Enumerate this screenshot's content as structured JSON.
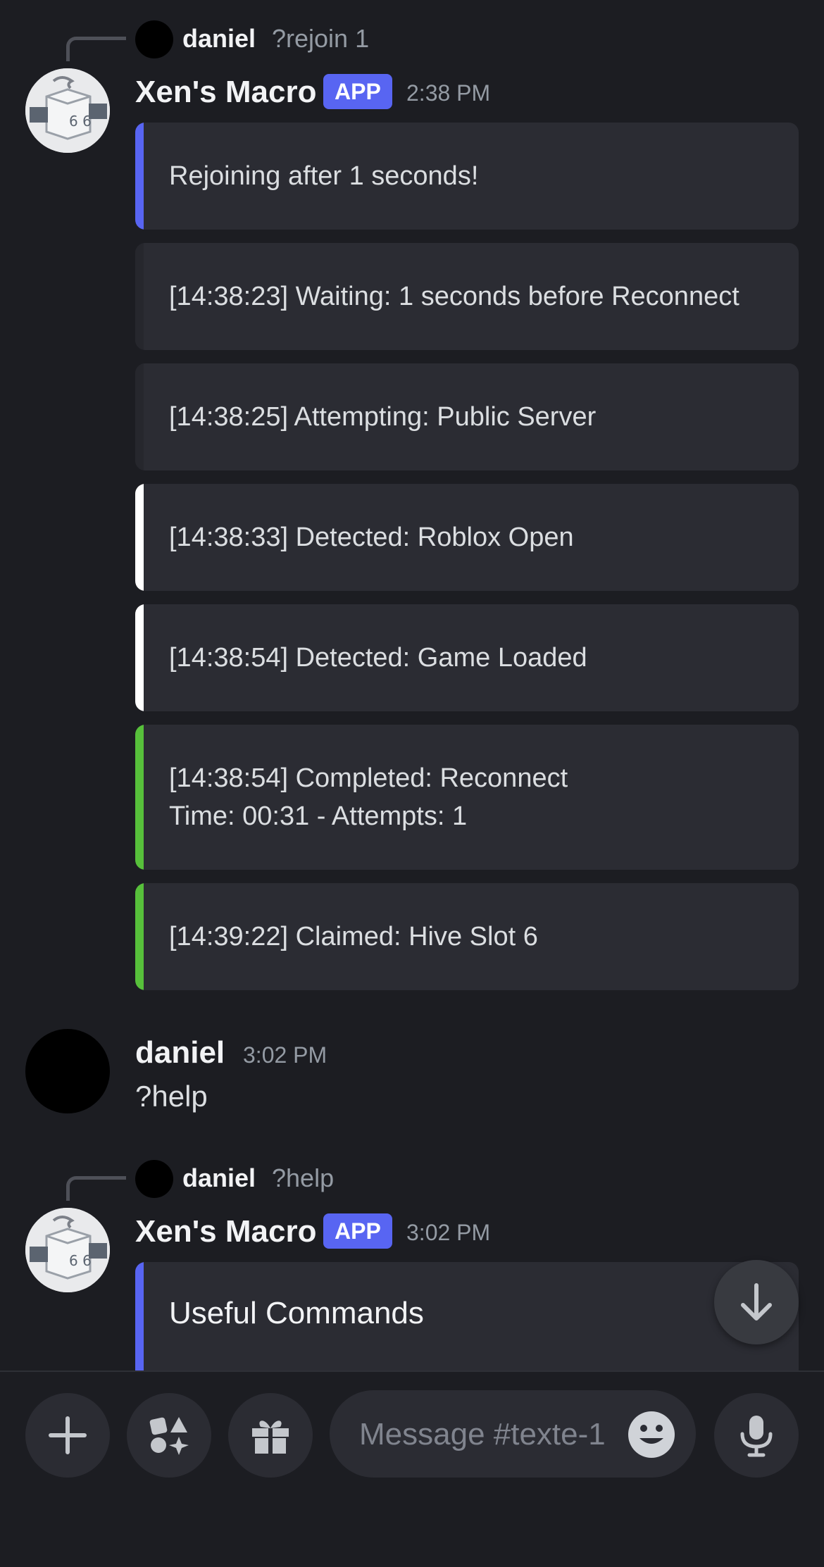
{
  "messages": {
    "m1": {
      "reply_author": "daniel",
      "reply_text": "?rejoin 1",
      "author": "Xen's Macro",
      "badge": "APP",
      "time": "2:38 PM",
      "embeds": [
        {
          "text": "Rejoining after 1 seconds!",
          "color": "#5865f2"
        },
        {
          "text": "[14:38:23] Waiting: 1 seconds before Reconnect",
          "color": "#2b2c33"
        },
        {
          "text": "[14:38:25] Attempting: Public Server",
          "color": "#2b2c33"
        },
        {
          "text": "[14:38:33] Detected: Roblox Open",
          "color": "#ffffff"
        },
        {
          "text": "[14:38:54] Detected: Game Loaded",
          "color": "#ffffff"
        },
        {
          "text": "[14:38:54] Completed: Reconnect\nTime: 00:31 - Attempts: 1",
          "color": "#57c03b"
        },
        {
          "text": "[14:39:22] Claimed: Hive Slot 6",
          "color": "#57c03b"
        }
      ]
    },
    "m2": {
      "author": "daniel",
      "time": "3:02 PM",
      "text": "?help"
    },
    "m3": {
      "reply_author": "daniel",
      "reply_text": "?help",
      "author": "Xen's Macro",
      "badge": "APP",
      "time": "3:02 PM",
      "embed_title": "Useful Commands",
      "embed_color": "#5865f2"
    }
  },
  "composer": {
    "placeholder": "Message #texte-1"
  }
}
